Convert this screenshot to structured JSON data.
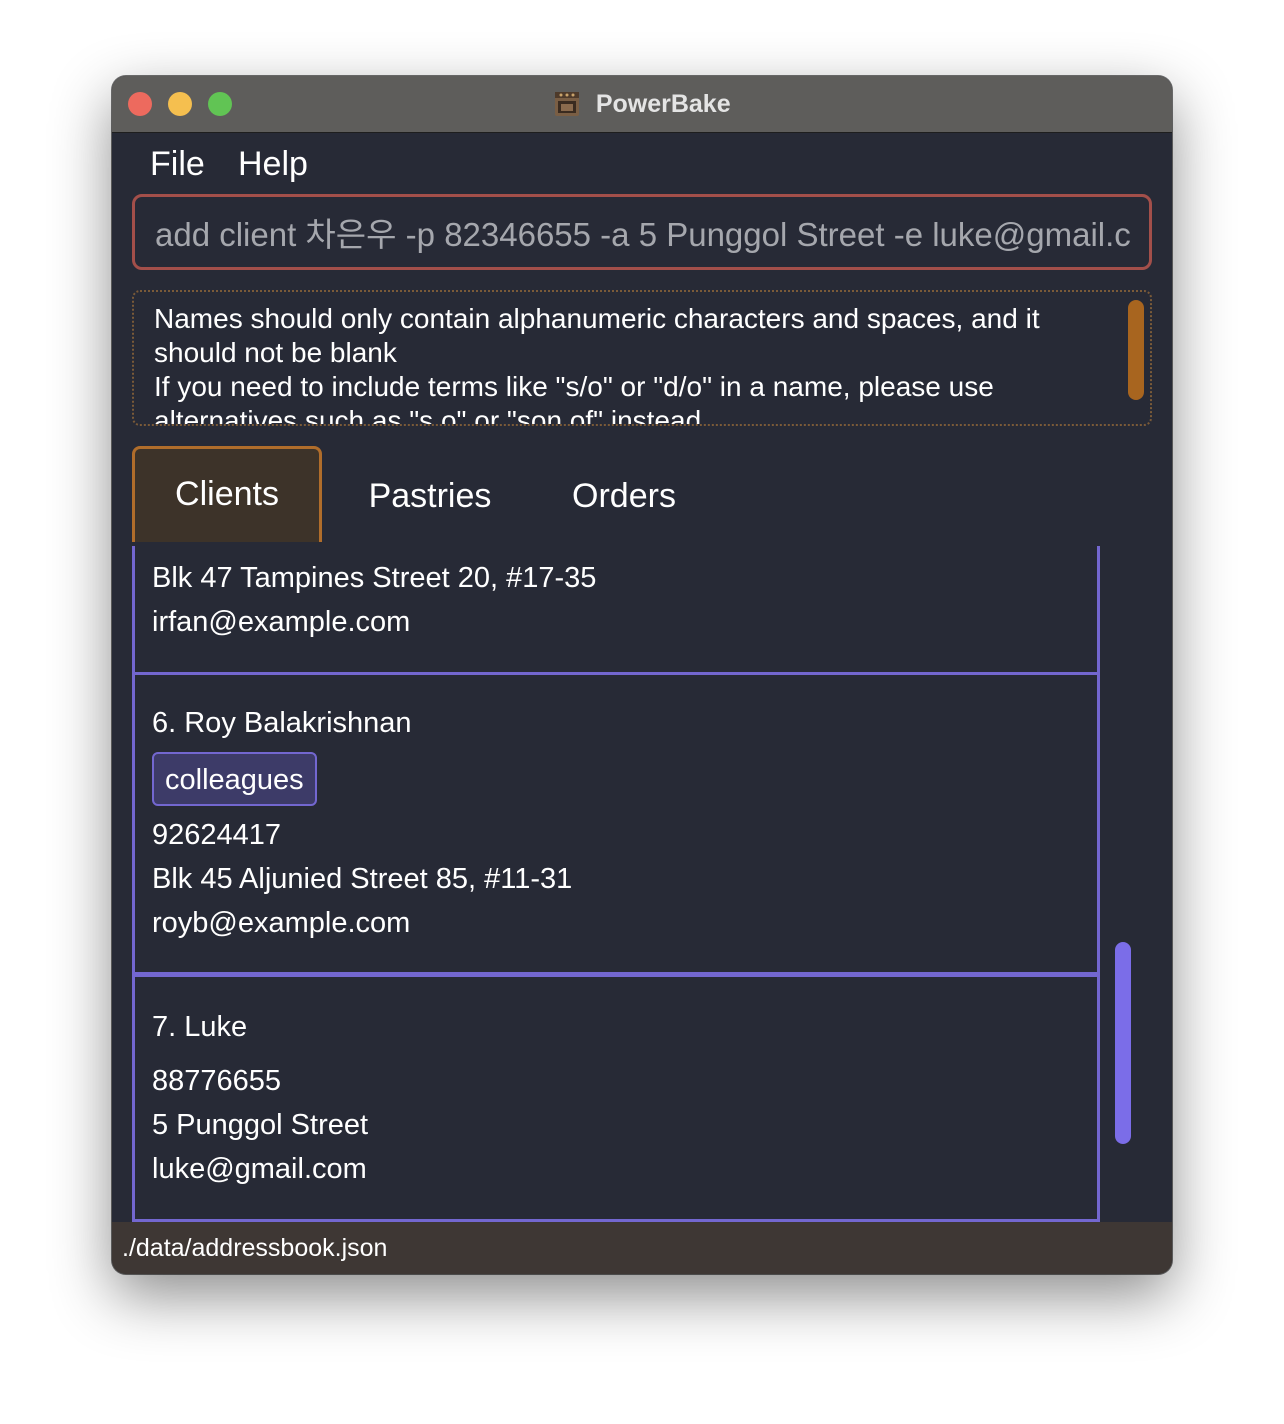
{
  "window": {
    "title": "PowerBake",
    "title_icon": "oven-icon"
  },
  "menu": {
    "file": "File",
    "help": "Help"
  },
  "command": {
    "value": "add client 차은우 -p 82346655 -a 5 Punggol Street -e luke@gmail.c"
  },
  "result": {
    "text": "Names should only contain alphanumeric characters and spaces, and it should not be blank\nIf you need to include terms like \"s/o\" or \"d/o\" in a name, please use alternatives such as \"s o\" or \"son of\" instead"
  },
  "tabs": {
    "clients": "Clients",
    "pastries": "Pastries",
    "orders": "Orders",
    "active": "Clients"
  },
  "clients": [
    {
      "name": "",
      "tags": [],
      "phone": "",
      "address": "Blk 47 Tampines Street 20, #17-35",
      "email": "irfan@example.com"
    },
    {
      "name": "6. Roy Balakrishnan",
      "tags": [
        "colleagues"
      ],
      "phone": "92624417",
      "address": "Blk 45 Aljunied Street 85, #11-31",
      "email": "royb@example.com"
    },
    {
      "name": "7. Luke",
      "tags": [],
      "phone": "88776655",
      "address": "5 Punggol Street",
      "email": "luke@gmail.com"
    }
  ],
  "status": {
    "path": "./data/addressbook.json"
  },
  "colors": {
    "window_bg": "#272a36",
    "titlebar": "#5e5d5b",
    "command_border": "#a34f4a",
    "result_border": "#7a5a38",
    "tab_active_bg": "#3d3329",
    "tab_active_border": "#b06d2b",
    "card_border": "#7367d0",
    "tag_bg": "#3d3b68",
    "scroll_thumb": "#7b6de8",
    "result_scroll_thumb": "#a8651f",
    "statusbar": "#3e3734"
  }
}
